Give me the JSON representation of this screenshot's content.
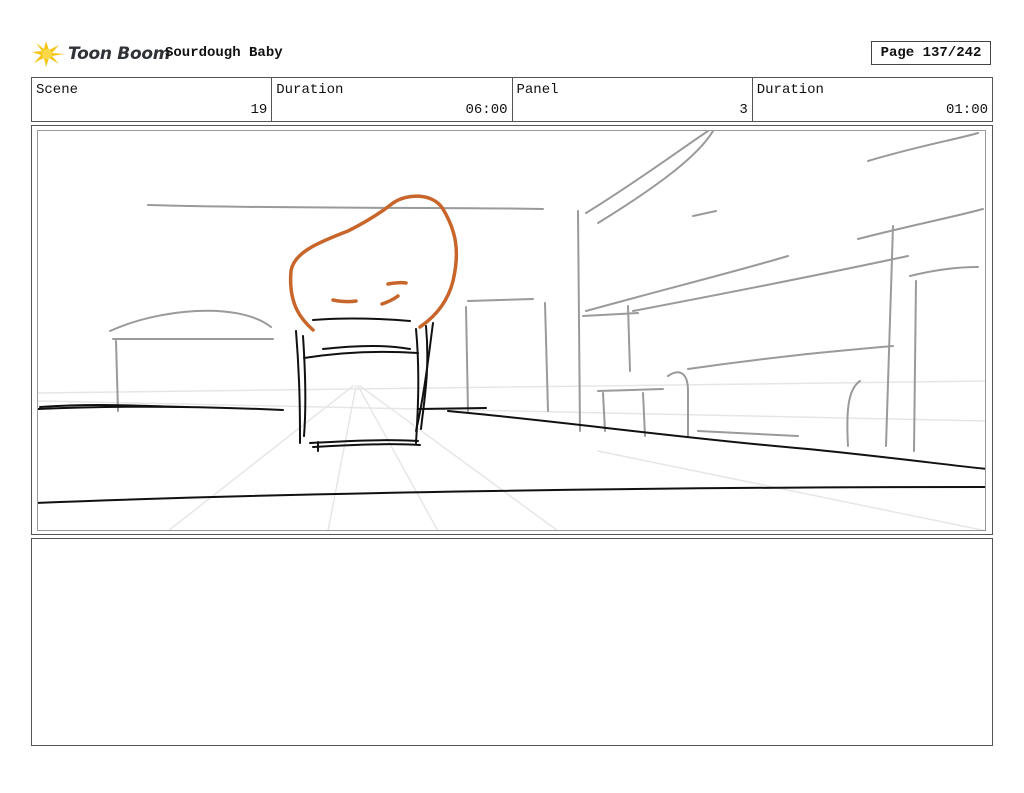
{
  "header": {
    "logo_text": "Toon Boom",
    "project_title": "Sourdough Baby",
    "page_label": "Page 137/242"
  },
  "info": {
    "scene_label": "Scene",
    "scene_value": "19",
    "scene_duration_label": "Duration",
    "scene_duration_value": "06:00",
    "panel_label": "Panel",
    "panel_value": "3",
    "panel_duration_label": "Duration",
    "panel_duration_value": "01:00"
  },
  "colors": {
    "logo_yellow": "#f5c518",
    "sketch_orange": "#c8652a",
    "sketch_gray": "#8a8a8a"
  }
}
